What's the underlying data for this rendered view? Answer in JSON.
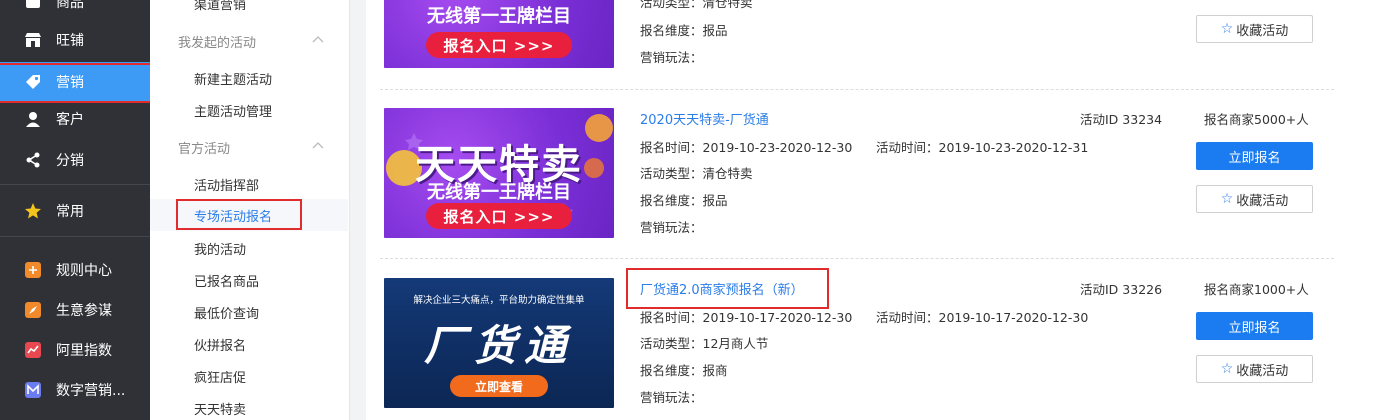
{
  "sidebar": {
    "items": [
      {
        "label": "商品",
        "icon": "box-icon"
      },
      {
        "label": "旺铺",
        "icon": "shop-icon"
      },
      {
        "label": "营销",
        "icon": "tag-icon",
        "active": true
      },
      {
        "label": "客户",
        "icon": "user-icon"
      },
      {
        "label": "分销",
        "icon": "share-icon"
      },
      {
        "label": "常用",
        "icon": "star-icon"
      },
      {
        "label": "规则中心",
        "icon": "rules-icon"
      },
      {
        "label": "生意参谋",
        "icon": "compass-icon"
      },
      {
        "label": "阿里指数",
        "icon": "trend-icon"
      },
      {
        "label": "数字营销...",
        "icon": "digital-icon"
      }
    ]
  },
  "submenu": {
    "top_item": "渠道营销",
    "group1": "我发起的活动",
    "group1_items": [
      "新建主题活动",
      "主题活动管理"
    ],
    "group2": "官方活动",
    "group2_items": [
      "活动指挥部",
      "专场活动报名",
      "我的活动",
      "已报名商品",
      "最低价查询",
      "伙拼报名",
      "疯狂店促",
      "天天特卖"
    ]
  },
  "activities": [
    {
      "partial": true,
      "banner": {
        "big": "",
        "mid": "无线第一王牌栏目",
        "pill": "报名入口 >>>"
      },
      "type_line": "活动类型：清仓特卖",
      "dimension": "报名维度：报品",
      "play": "营销玩法：",
      "fav_label": "收藏活动"
    },
    {
      "title": "2020天天特卖-厂货通",
      "activity_id": "活动ID 33234",
      "merchants": "报名商家5000+人",
      "signup_time": "报名时间：2019-10-23-2020-12-30",
      "activity_time": "活动时间：2019-10-23-2020-12-31",
      "type_line": "活动类型：清仓特卖",
      "dimension": "报名维度：报品",
      "play": "营销玩法：",
      "join_label": "立即报名",
      "fav_label": "收藏活动",
      "banner": {
        "big": "天天特卖",
        "mid": "无线第一王牌栏目",
        "pill": "报名入口 >>>"
      }
    },
    {
      "title": "厂货通2.0商家预报名（新）",
      "activity_id": "活动ID 33226",
      "merchants": "报名商家1000+人",
      "signup_time": "报名时间：2019-10-17-2020-12-30",
      "activity_time": "活动时间：2019-10-17-2020-12-30",
      "type_line": "活动类型：12月商人节",
      "dimension": "报名维度：报商",
      "play": "营销玩法：",
      "join_label": "立即报名",
      "fav_label": "收藏活动",
      "banner": {
        "top": "解决企业三大痛点，平台助力确定性集单",
        "big": "厂货通",
        "pill": "立即查看"
      }
    }
  ],
  "colors": {
    "accent": "#1a7cf0",
    "link": "#2b7de9",
    "sidebar_bg": "#2f3136",
    "sidebar_active": "#3e9bf5",
    "highlight": "#e02c2c"
  }
}
